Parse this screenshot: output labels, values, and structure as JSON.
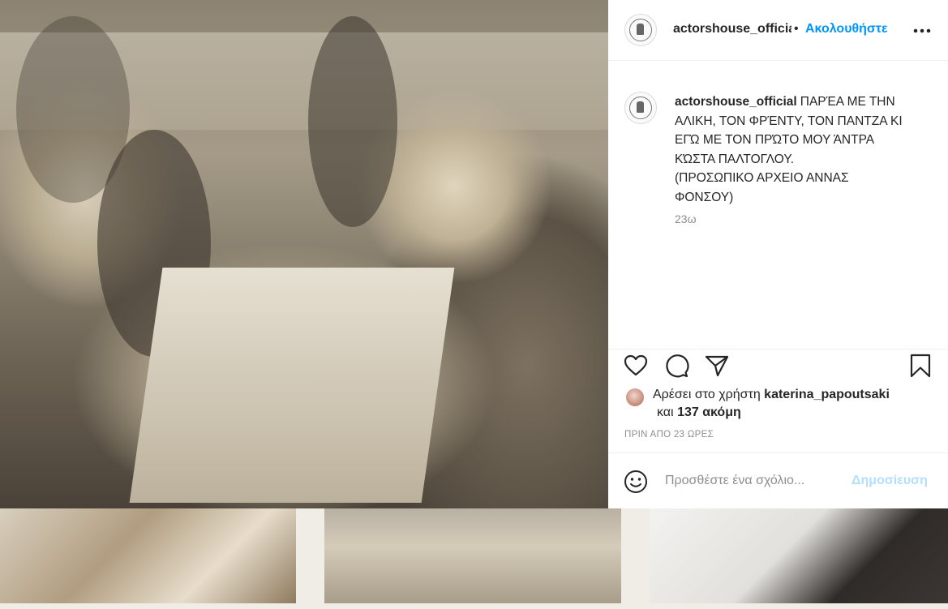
{
  "post": {
    "username": "actorshouse_official",
    "follow_separator": "•",
    "follow_label": "Ακολουθήστε",
    "more_icon": "more-horizontal-icon",
    "caption_lines": [
      "ΠΑΡΈΑ ΜΕ ΤΗΝ",
      "ΑΛΙΚΗ, ΤΟΝ ΦΡΈΝΤΥ, ΤΟΝ ΠΑΝΤΖΑ ΚΙ",
      "ΕΓΏ ΜΕ ΤΟΝ ΠΡΏΤΟ ΜΟΥ ΆΝΤΡΑ",
      "ΚΏΣΤΑ ΠΑΛΤΟΓΛΟΥ.",
      "(ΠΡΟΣΩΠΙΚΟ ΑΡΧΕΙΟ ΑΝΝΑΣ",
      "ΦΟΝΣΟΥ)"
    ],
    "caption_time": "23ω",
    "likes_prefix": "Αρέσει στο χρήστη",
    "likes_user": "katerina_papoutsaki",
    "likes_and": "και",
    "likes_count": "137 ακόμη",
    "timestamp": "ΠΡΙΝ ΑΠΟ 23 ΩΡΕΣ",
    "comment_placeholder": "Προσθέστε ένα σχόλιο...",
    "post_button": "Δημοσίευση"
  },
  "colors": {
    "link_blue": "#0095f6",
    "post_disabled": "#b2dffc",
    "secondary_text": "#8e8e8e"
  },
  "icons": [
    "heart-icon",
    "comment-icon",
    "share-icon",
    "bookmark-icon",
    "emoji-icon"
  ]
}
